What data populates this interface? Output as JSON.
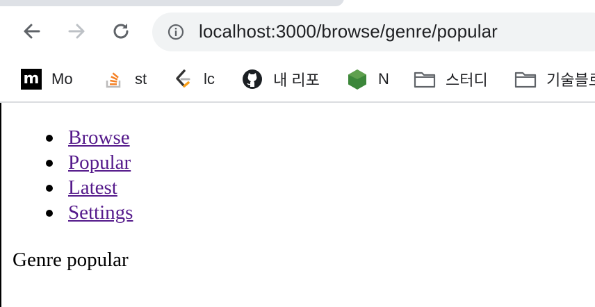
{
  "browser": {
    "url": "localhost:3000/browse/genre/popular",
    "icons": {
      "back": "back-arrow-icon",
      "forward": "forward-arrow-icon",
      "reload": "reload-icon",
      "info": "info-icon"
    }
  },
  "bookmarks": [
    {
      "label": "Mo",
      "icon": "medium-icon",
      "glyph": "m"
    },
    {
      "label": "st",
      "icon": "stackoverflow-icon"
    },
    {
      "label": "lc",
      "icon": "leetcode-icon"
    },
    {
      "label": "내 리포",
      "icon": "github-icon"
    },
    {
      "label": "N",
      "icon": "nodejs-icon"
    },
    {
      "label": "스터디",
      "icon": "folder-icon"
    },
    {
      "label": "기술블로",
      "icon": "folder-icon"
    }
  ],
  "page": {
    "nav": [
      "Browse",
      "Popular",
      "Latest",
      "Settings"
    ],
    "heading": "Genre popular"
  },
  "colors": {
    "link": "#551a8b",
    "omnibox": "#f1f3f4",
    "tab": "#dee1e6",
    "nodejs": "#3c873a",
    "stackoverflow": "#f48024"
  }
}
